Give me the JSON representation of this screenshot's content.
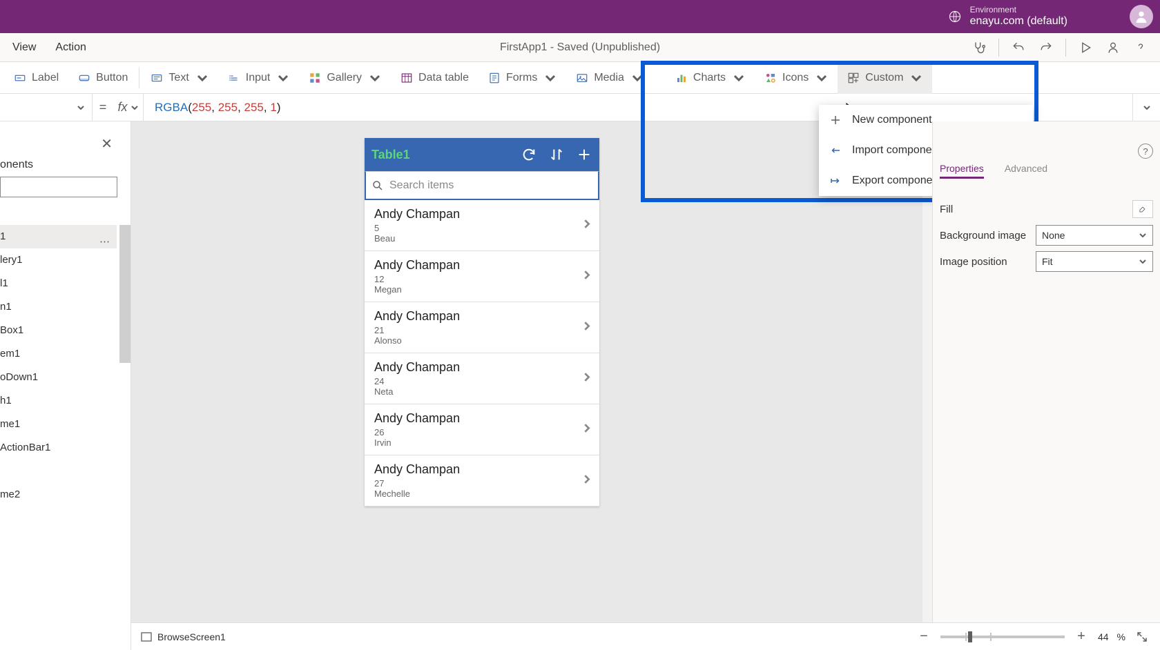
{
  "titlebar": {
    "env_label": "Environment",
    "env_value": "enayu.com (default)"
  },
  "menubar": {
    "menus": [
      "View",
      "Action"
    ],
    "apptitle": "FirstApp1 - Saved (Unpublished)"
  },
  "ribbon": {
    "label": "Label",
    "button": "Button",
    "text": "Text",
    "input": "Input",
    "gallery": "Gallery",
    "datatable": "Data table",
    "forms": "Forms",
    "media": "Media",
    "charts": "Charts",
    "icons": "Icons",
    "custom": "Custom"
  },
  "formula": {
    "eq": "=",
    "fx": "fx",
    "fn": "RGBA",
    "args": [
      "255",
      "255",
      "255",
      "1"
    ]
  },
  "tree": {
    "section": "onents",
    "selected": "1",
    "items": [
      "lery1",
      "l1",
      "n1",
      "Box1",
      "em1",
      "oDown1",
      "h1",
      "me1",
      "ActionBar1",
      "",
      "me2"
    ]
  },
  "app": {
    "title": "Table1",
    "search_placeholder": "Search items",
    "rows": [
      {
        "name": "Andy Champan",
        "line2": "5",
        "line3": "Beau"
      },
      {
        "name": "Andy Champan",
        "line2": "12",
        "line3": "Megan"
      },
      {
        "name": "Andy Champan",
        "line2": "21",
        "line3": "Alonso"
      },
      {
        "name": "Andy Champan",
        "line2": "24",
        "line3": "Neta"
      },
      {
        "name": "Andy Champan",
        "line2": "26",
        "line3": "Irvin"
      },
      {
        "name": "Andy Champan",
        "line2": "27",
        "line3": "Mechelle"
      }
    ]
  },
  "custom_menu": {
    "items": [
      {
        "key": "new",
        "label": "New component"
      },
      {
        "key": "import",
        "label": "Import component"
      },
      {
        "key": "export",
        "label": "Export components"
      }
    ]
  },
  "properties": {
    "tab_properties": "Properties",
    "tab_advanced": "Advanced",
    "fill_label": "Fill",
    "bgimage_label": "Background image",
    "bgimage_value": "None",
    "imgpos_label": "Image position",
    "imgpos_value": "Fit",
    "help": "?"
  },
  "status": {
    "breadcrumb": "BrowseScreen1",
    "zoom_value": "44",
    "zoom_unit": "%",
    "minus": "−",
    "plus": "+"
  }
}
